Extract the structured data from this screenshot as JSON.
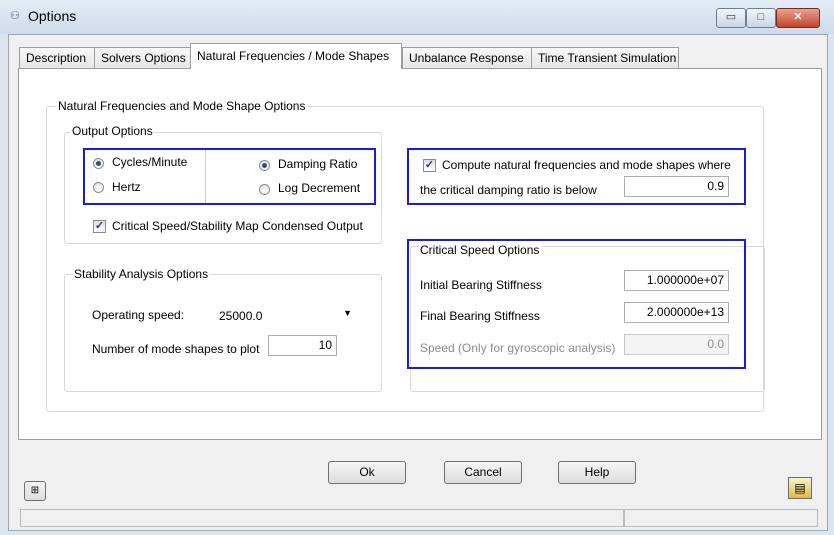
{
  "window": {
    "title": "Options",
    "minimize_glyph": "▭",
    "maximize_glyph": "□",
    "close_glyph": "✕"
  },
  "tabs": [
    {
      "label": "Description",
      "active": false
    },
    {
      "label": "Solvers Options",
      "active": false
    },
    {
      "label": "Natural Frequencies / Mode Shapes",
      "active": true
    },
    {
      "label": "Unbalance Response",
      "active": false
    },
    {
      "label": "Time Transient Simulation",
      "active": false
    }
  ],
  "panel": {
    "outer_group_title": "Natural Frequencies and Mode Shape Options",
    "output_options": {
      "title": "Output Options",
      "units": [
        {
          "label": "Cycles/Minute",
          "selected": true
        },
        {
          "label": "Hertz",
          "selected": false
        }
      ],
      "damping": [
        {
          "label": "Damping Ratio",
          "selected": true
        },
        {
          "label": "Log Decrement",
          "selected": false
        }
      ],
      "condensed_output": {
        "label": "Critical Speed/Stability Map Condensed Output",
        "checked": true
      }
    },
    "compute": {
      "checkbox_label": "Compute natural frequencies and mode shapes where",
      "checked": true,
      "row_label": "the critical damping ratio is below",
      "value": "0.9"
    },
    "stability": {
      "title": "Stability Analysis Options",
      "operating_speed_label": "Operating speed:",
      "operating_speed_value": "25000.0",
      "mode_shapes_label": "Number of mode shapes to plot",
      "mode_shapes_value": "10"
    },
    "critical_speed": {
      "title": "Critical Speed Options",
      "initial_label": "Initial Bearing Stiffness",
      "initial_value": "1.000000e+07",
      "final_label": "Final Bearing Stiffness",
      "final_value": "2.000000e+13",
      "speed_label": "Speed (Only for gyroscopic analysis)",
      "speed_value": "0.0"
    }
  },
  "buttons": {
    "ok": "Ok",
    "cancel": "Cancel",
    "help": "Help"
  },
  "icons": {
    "left_icon": "pin-icon",
    "right_icon": "paste-icon"
  },
  "colors": {
    "highlight": "#1a1ae6"
  }
}
